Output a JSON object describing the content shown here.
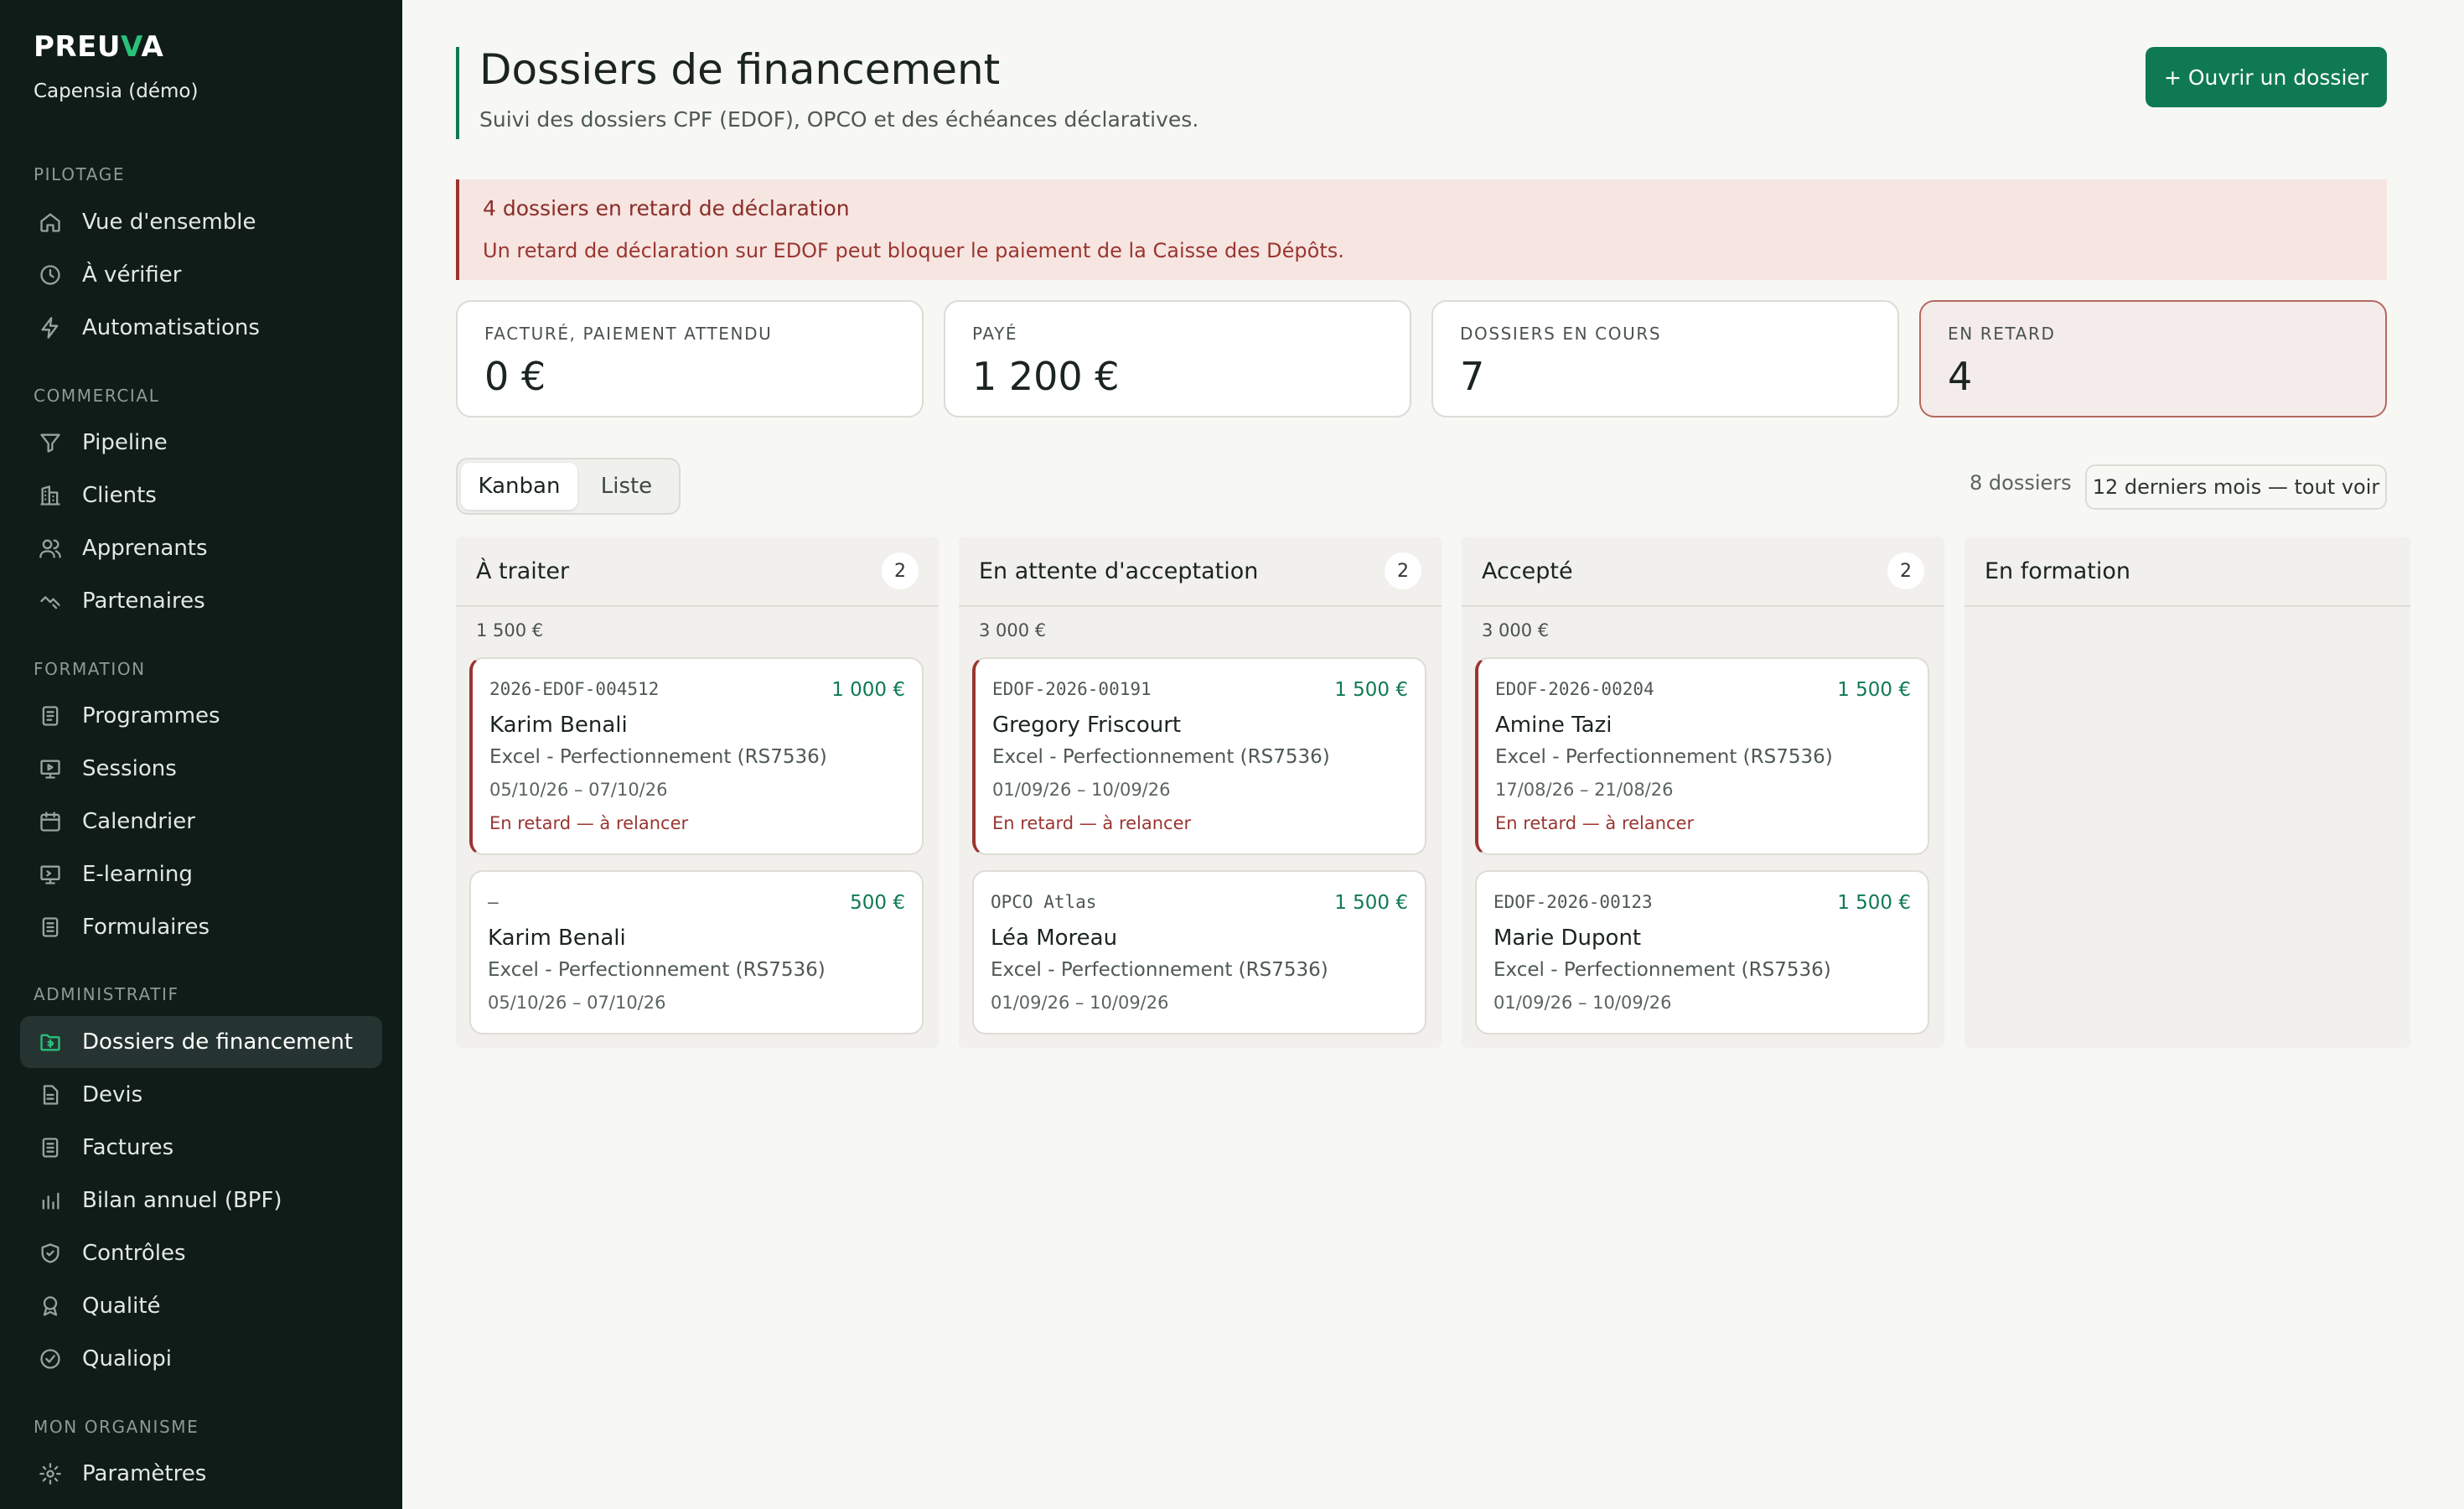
{
  "sidebar": {
    "brand": {
      "prefix": "PREU",
      "accent": "V",
      "suffix": "A"
    },
    "org": "Capensia (démo)",
    "sections": {
      "pilotage": "PILOTAGE",
      "commercial": "COMMERCIAL",
      "formation": "FORMATION",
      "administratif": "ADMINISTRATIF",
      "organisme": "MON ORGANISME"
    },
    "items": {
      "overview": "Vue d'ensemble",
      "verify": "À vérifier",
      "automations": "Automatisations",
      "pipeline": "Pipeline",
      "clients": "Clients",
      "learners": "Apprenants",
      "partners": "Partenaires",
      "programs": "Programmes",
      "sessions": "Sessions",
      "calendar": "Calendrier",
      "elearning": "E-learning",
      "forms": "Formulaires",
      "funding": "Dossiers de financement",
      "quotes": "Devis",
      "invoices": "Factures",
      "bpf": "Bilan annuel (BPF)",
      "controls": "Contrôles",
      "quality": "Qualité",
      "qualiopi": "Qualiopi",
      "settings": "Paramètres"
    }
  },
  "header": {
    "title": "Dossiers de financement",
    "subtitle": "Suivi des dossiers CPF (EDOF), OPCO et des échéances déclaratives.",
    "open_button": "+ Ouvrir un dossier"
  },
  "alert": {
    "title": "4 dossiers en retard de déclaration",
    "text": "Un retard de déclaration sur EDOF peut bloquer le paiement de la Caisse des Dépôts."
  },
  "kpis": [
    {
      "label": "FACTURÉ, PAIEMENT ATTENDU",
      "value": "0 €"
    },
    {
      "label": "PAYÉ",
      "value": "1 200 €"
    },
    {
      "label": "DOSSIERS EN COURS",
      "value": "7"
    },
    {
      "label": "EN RETARD",
      "value": "4"
    }
  ],
  "view_toggle": {
    "kanban": "Kanban",
    "list": "Liste"
  },
  "count_label": "8 dossiers",
  "period_button": "12 derniers mois — tout voir",
  "columns": [
    {
      "title": "À traiter",
      "count": "2",
      "sum": "1 500 €",
      "cards": [
        {
          "ref": "2026-EDOF-004512",
          "amount": "1 000 €",
          "name": "Karim Benali",
          "program": "Excel - Perfectionnement (RS7536)",
          "dates": "05/10/26 – 07/10/26",
          "warning": "En retard — à relancer"
        },
        {
          "ref": "—",
          "amount": "500 €",
          "name": "Karim Benali",
          "program": "Excel - Perfectionnement (RS7536)",
          "dates": "05/10/26 – 07/10/26"
        }
      ]
    },
    {
      "title": "En attente d'acceptation",
      "count": "2",
      "sum": "3 000 €",
      "cards": [
        {
          "ref": "EDOF-2026-00191",
          "amount": "1 500 €",
          "name": "Gregory Friscourt",
          "program": "Excel - Perfectionnement (RS7536)",
          "dates": "01/09/26 – 10/09/26",
          "warning": "En retard — à relancer"
        },
        {
          "ref": "OPCO Atlas",
          "amount": "1 500 €",
          "name": "Léa Moreau",
          "program": "Excel - Perfectionnement (RS7536)",
          "dates": "01/09/26 – 10/09/26"
        }
      ]
    },
    {
      "title": "Accepté",
      "count": "2",
      "sum": "3 000 €",
      "cards": [
        {
          "ref": "EDOF-2026-00204",
          "amount": "1 500 €",
          "name": "Amine Tazi",
          "program": "Excel - Perfectionnement (RS7536)",
          "dates": "17/08/26 – 21/08/26",
          "warning": "En retard — à relancer"
        },
        {
          "ref": "EDOF-2026-00123",
          "amount": "1 500 €",
          "name": "Marie Dupont",
          "program": "Excel - Perfectionnement (RS7536)",
          "dates": "01/09/26 – 10/09/26"
        }
      ]
    },
    {
      "title": "En formation"
    }
  ],
  "colors": {
    "accent": "#0f7a52",
    "sidebar": "#0f1c18",
    "danger": "#9a3530",
    "brand_accent": "#29c07a"
  }
}
